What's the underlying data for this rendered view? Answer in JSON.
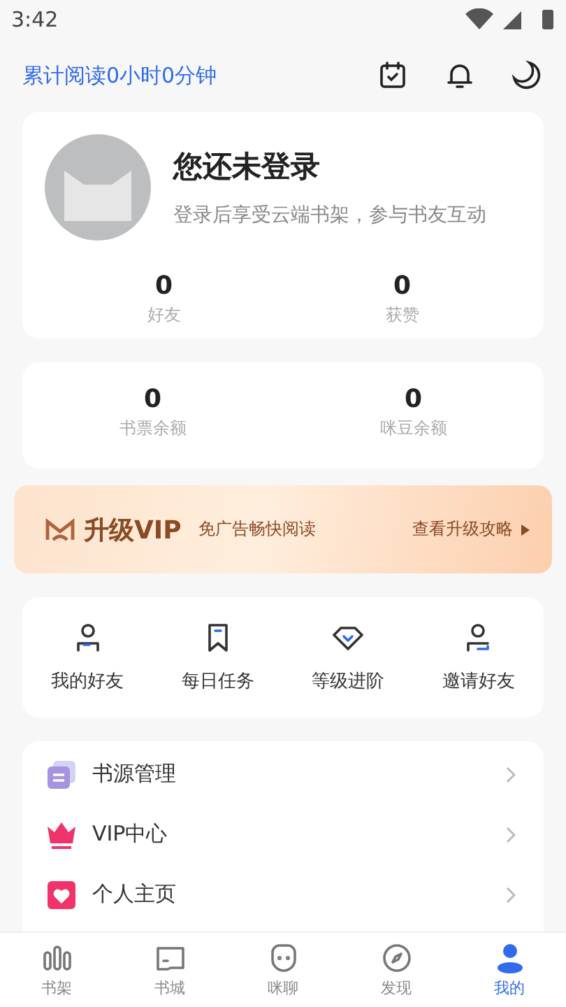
{
  "status_bar": {
    "time": "3:42"
  },
  "header": {
    "reading_time": "累计阅读0小时0分钟"
  },
  "profile": {
    "name": "您还未登录",
    "subtitle": "登录后享受云端书架，参与书友互动",
    "stats": [
      {
        "value": "0",
        "label": "好友"
      },
      {
        "value": "0",
        "label": "获赞"
      }
    ]
  },
  "balances": [
    {
      "value": "0",
      "label": "书票余额"
    },
    {
      "value": "0",
      "label": "咪豆余额"
    }
  ],
  "vip_banner": {
    "title": "升级VIP",
    "tagline": "免广告畅快阅读",
    "link": "查看升级攻略"
  },
  "shortcuts": [
    {
      "kind": "friend",
      "label": "我的好友"
    },
    {
      "kind": "task",
      "label": "每日任务"
    },
    {
      "kind": "level",
      "label": "等级进阶"
    },
    {
      "kind": "invite",
      "label": "邀请好友"
    }
  ],
  "menu": [
    {
      "kind": "source",
      "label": "书源管理"
    },
    {
      "kind": "vip",
      "label": "VIP中心"
    },
    {
      "kind": "home",
      "label": "个人主页"
    }
  ],
  "tab_bar": [
    {
      "kind": "shelf",
      "label": "书架",
      "selected": false
    },
    {
      "kind": "store",
      "label": "书城",
      "selected": false
    },
    {
      "kind": "chat",
      "label": "咪聊",
      "selected": false
    },
    {
      "kind": "discover",
      "label": "发现",
      "selected": false
    },
    {
      "kind": "me",
      "label": "我的",
      "selected": true
    }
  ]
}
